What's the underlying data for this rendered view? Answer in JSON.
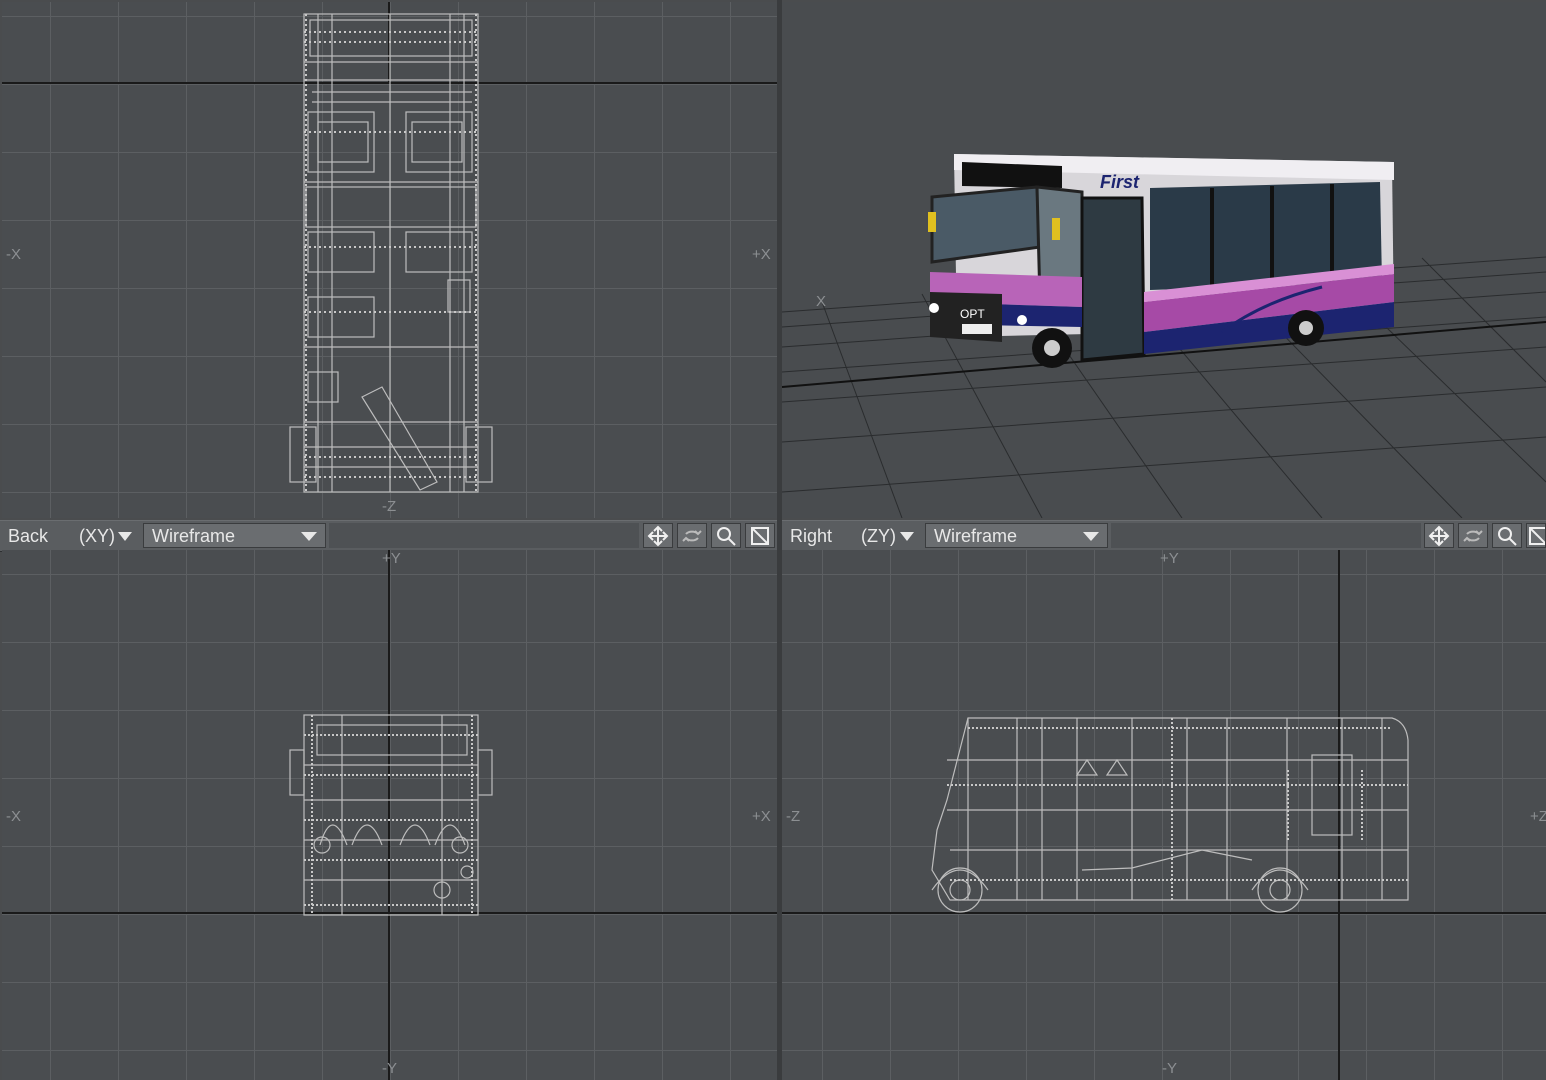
{
  "viewports": {
    "top_left": {
      "axis_labels": {
        "left": "-X",
        "right": "+X",
        "bottom": "-Z"
      }
    },
    "top_right": {
      "axis_label": "X"
    },
    "bottom_left": {
      "view": "Back",
      "axis": "(XY)",
      "mode": "Wireframe",
      "axis_labels": {
        "top": "+Y",
        "left": "-X",
        "right": "+X",
        "bottom": "-Y"
      }
    },
    "bottom_right": {
      "view": "Right",
      "axis": "(ZY)",
      "mode": "Wireframe",
      "axis_labels": {
        "top": "+Y",
        "left": "-Z",
        "right": "+Z",
        "bottom": "-Y"
      }
    }
  },
  "bus": {
    "brand": "First",
    "destination": "OPT",
    "colors": {
      "body": "#e8e6ea",
      "stripe_purple": "#a64aa6",
      "stripe_pink": "#d990d5",
      "skirt": "#1c2470",
      "wire": "#bdbdbd"
    }
  },
  "icons": [
    "move-icon",
    "rotate-icon",
    "zoom-icon",
    "maximize-icon"
  ]
}
